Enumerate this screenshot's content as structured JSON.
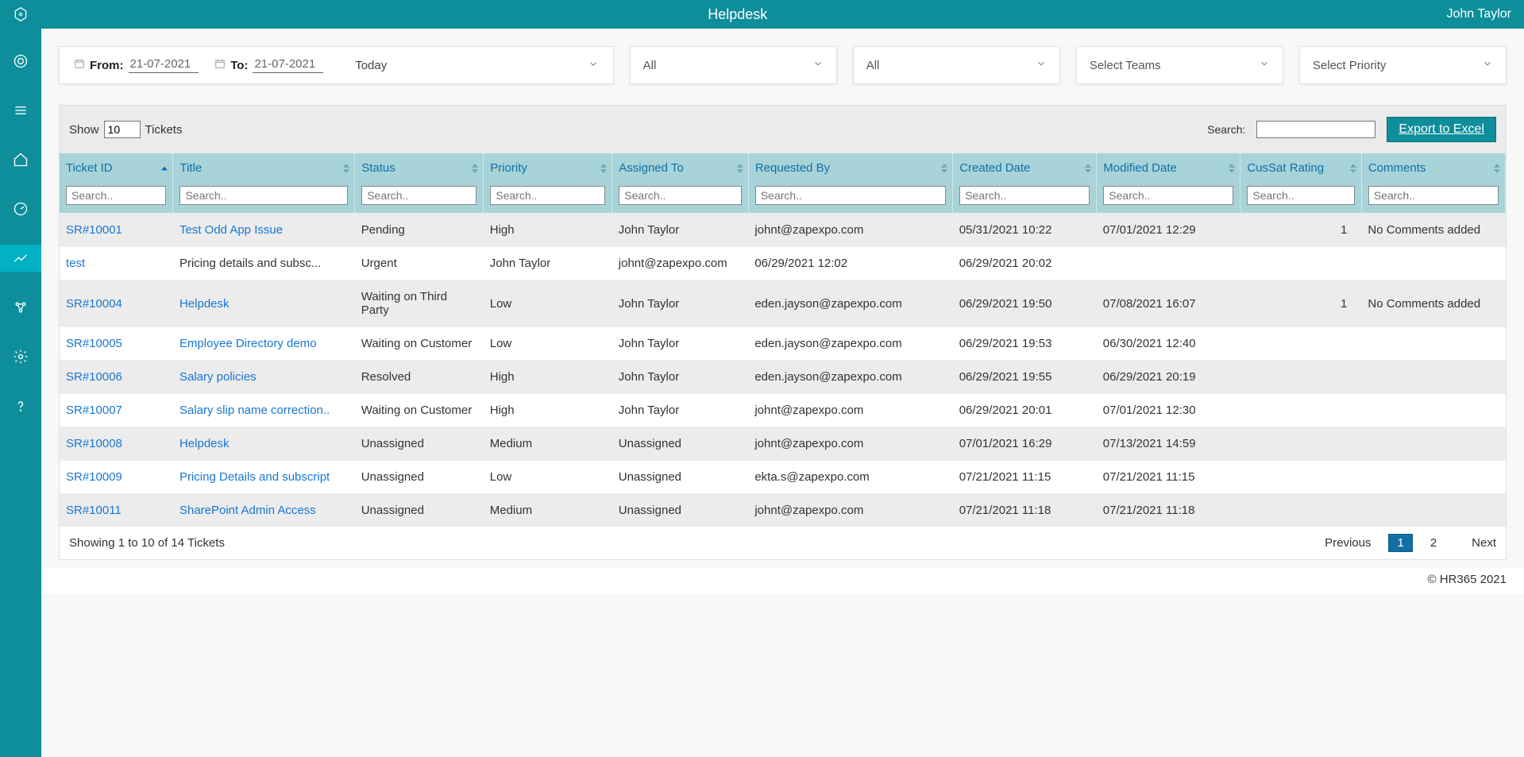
{
  "header": {
    "title": "Helpdesk",
    "user": "John Taylor"
  },
  "filters": {
    "from_label": "From:",
    "from_value": "21-07-2021",
    "to_label": "To:",
    "to_value": "21-07-2021",
    "preset": "Today",
    "dd1": "All",
    "dd2": "All",
    "dd3": "Select Teams",
    "dd4": "Select Priority"
  },
  "panel": {
    "show_label": "Show",
    "show_value": "10",
    "tickets_label": "Tickets",
    "search_label": "Search:",
    "export_label": "Export to Excel"
  },
  "columns": [
    {
      "key": "ticket_id",
      "label": "Ticket ID",
      "width": "7.5%"
    },
    {
      "key": "title",
      "label": "Title",
      "width": "12%"
    },
    {
      "key": "status",
      "label": "Status",
      "width": "8.5%"
    },
    {
      "key": "priority",
      "label": "Priority",
      "width": "8.5%"
    },
    {
      "key": "assigned_to",
      "label": "Assigned To",
      "width": "9%"
    },
    {
      "key": "requested_by",
      "label": "Requested By",
      "width": "13.5%"
    },
    {
      "key": "created_date",
      "label": "Created Date",
      "width": "9.5%"
    },
    {
      "key": "modified_date",
      "label": "Modified Date",
      "width": "9.5%"
    },
    {
      "key": "cussat",
      "label": "CusSat Rating",
      "width": "8%"
    },
    {
      "key": "comments",
      "label": "Comments",
      "width": "9.5%"
    }
  ],
  "search_placeholder": "Search..",
  "rows": [
    {
      "ticket_id": "SR#10001",
      "title": "Test Odd App Issue",
      "status": "Pending",
      "priority": "High",
      "assigned_to": "John Taylor",
      "requested_by": "johnt@zapexpo.com",
      "created_date": "05/31/2021 10:22",
      "modified_date": "07/01/2021 12:29",
      "cussat": "1",
      "comments": "No Comments added",
      "id_link": true,
      "title_link": true
    },
    {
      "ticket_id": "test",
      "title": "Pricing details and subsc...",
      "status": "Urgent",
      "priority": "John Taylor",
      "assigned_to": "johnt@zapexpo.com",
      "requested_by": "06/29/2021 12:02",
      "created_date": "06/29/2021 20:02",
      "modified_date": "",
      "cussat": "",
      "comments": "",
      "id_link": true,
      "title_link": false
    },
    {
      "ticket_id": "SR#10004",
      "title": "Helpdesk",
      "status": "Waiting on Third Party",
      "priority": "Low",
      "assigned_to": "John Taylor",
      "requested_by": "eden.jayson@zapexpo.com",
      "created_date": "06/29/2021 19:50",
      "modified_date": "07/08/2021 16:07",
      "cussat": "1",
      "comments": "No Comments added",
      "id_link": true,
      "title_link": true
    },
    {
      "ticket_id": "SR#10005",
      "title": "Employee Directory demo",
      "status": "Waiting on Customer",
      "priority": "Low",
      "assigned_to": "John Taylor",
      "requested_by": "eden.jayson@zapexpo.com",
      "created_date": "06/29/2021 19:53",
      "modified_date": "06/30/2021 12:40",
      "cussat": "",
      "comments": "",
      "id_link": true,
      "title_link": true
    },
    {
      "ticket_id": "SR#10006",
      "title": "Salary policies",
      "status": "Resolved",
      "priority": "High",
      "assigned_to": "John Taylor",
      "requested_by": "eden.jayson@zapexpo.com",
      "created_date": "06/29/2021 19:55",
      "modified_date": "06/29/2021 20:19",
      "cussat": "",
      "comments": "",
      "id_link": true,
      "title_link": true
    },
    {
      "ticket_id": "SR#10007",
      "title": "Salary slip name correction..",
      "status": "Waiting on Customer",
      "priority": "High",
      "assigned_to": "John Taylor",
      "requested_by": "johnt@zapexpo.com",
      "created_date": "06/29/2021 20:01",
      "modified_date": "07/01/2021 12:30",
      "cussat": "",
      "comments": "",
      "id_link": true,
      "title_link": true
    },
    {
      "ticket_id": "SR#10008",
      "title": "Helpdesk",
      "status": "Unassigned",
      "priority": "Medium",
      "assigned_to": "Unassigned",
      "requested_by": "johnt@zapexpo.com",
      "created_date": "07/01/2021 16:29",
      "modified_date": "07/13/2021 14:59",
      "cussat": "",
      "comments": "",
      "id_link": true,
      "title_link": true
    },
    {
      "ticket_id": "SR#10009",
      "title": "Pricing Details and subscript",
      "status": "Unassigned",
      "priority": "Low",
      "assigned_to": "Unassigned",
      "requested_by": "ekta.s@zapexpo.com",
      "created_date": "07/21/2021 11:15",
      "modified_date": "07/21/2021 11:15",
      "cussat": "",
      "comments": "",
      "id_link": true,
      "title_link": true
    },
    {
      "ticket_id": "SR#10011",
      "title": "SharePoint Admin Access",
      "status": "Unassigned",
      "priority": "Medium",
      "assigned_to": "Unassigned",
      "requested_by": "johnt@zapexpo.com",
      "created_date": "07/21/2021 11:18",
      "modified_date": "07/21/2021 11:18",
      "cussat": "",
      "comments": "",
      "id_link": true,
      "title_link": true
    }
  ],
  "footer_info": "Showing 1 to 10 of 14 Tickets",
  "pager": {
    "prev": "Previous",
    "pages": [
      "1",
      "2"
    ],
    "next": "Next",
    "active": "1"
  },
  "copyright": "© HR365 2021"
}
